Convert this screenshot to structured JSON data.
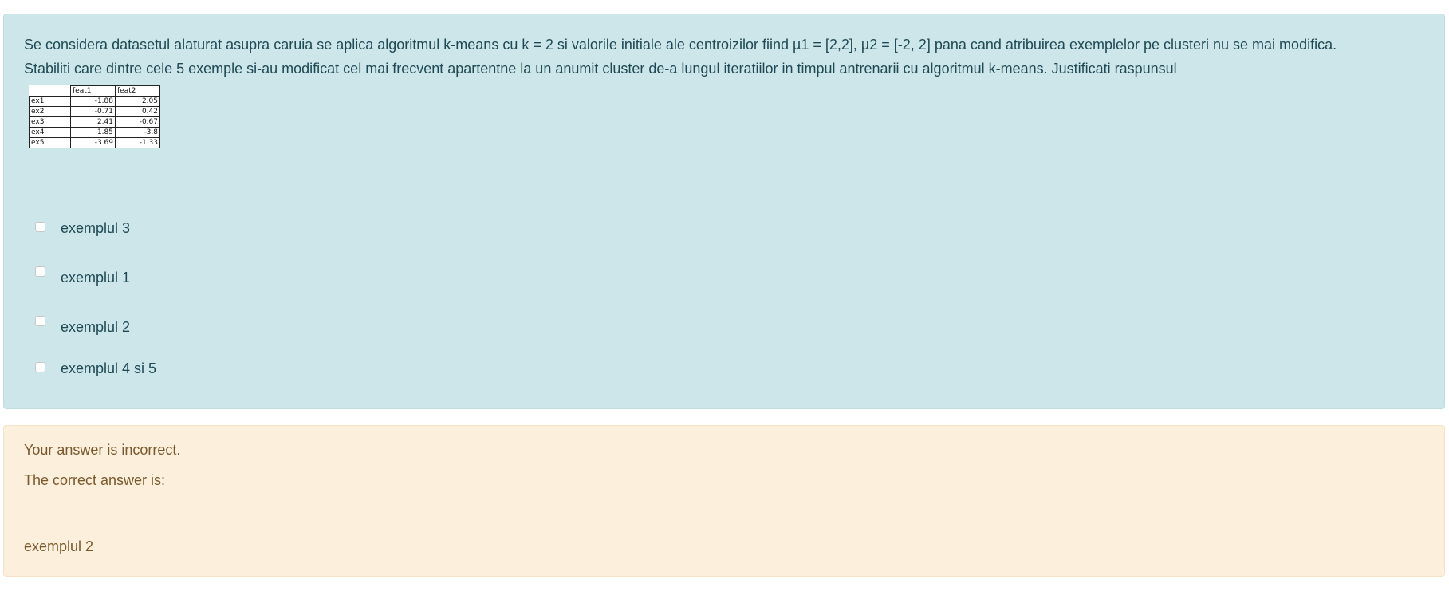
{
  "question": {
    "text_line1": "Se considera datasetul alaturat asupra caruia se aplica algoritmul k-means cu k = 2 si valorile initiale ale centroizilor fiind µ1 = [2,2], µ2 = [-2, 2] pana cand atribuirea exemplelor pe clusteri nu se mai modifica.",
    "text_line2": "Stabiliti care dintre cele 5 exemple si-au modificat cel mai frecvent apartentne la un anumit cluster de-a lungul iteratiilor in timpul antrenarii cu algoritmul k-means. Justificati raspunsul",
    "table": {
      "headers": [
        "feat1",
        "feat2"
      ],
      "rows": [
        {
          "name": "ex1",
          "feat1": "-1.88",
          "feat2": "2.05"
        },
        {
          "name": "ex2",
          "feat1": "-0.71",
          "feat2": "0.42"
        },
        {
          "name": "ex3",
          "feat1": "2.41",
          "feat2": "-0.67"
        },
        {
          "name": "ex4",
          "feat1": "1.85",
          "feat2": "-3.8"
        },
        {
          "name": "ex5",
          "feat1": "-3.69",
          "feat2": "-1.33"
        }
      ]
    },
    "options": [
      {
        "label": "exemplul 3",
        "checked": false
      },
      {
        "label": "exemplul 1",
        "checked": false
      },
      {
        "label": "exemplul 2",
        "checked": false
      },
      {
        "label": "exemplul 4 si 5",
        "checked": false
      }
    ]
  },
  "feedback": {
    "status": "Your answer is incorrect.",
    "correct_intro": "The correct answer is:",
    "correct_answer": "exemplul 2"
  },
  "colors": {
    "question_bg": "#cde6e9",
    "question_text": "#1f4a55",
    "feedback_bg": "#fcefdc",
    "feedback_text": "#7a5a2c"
  }
}
